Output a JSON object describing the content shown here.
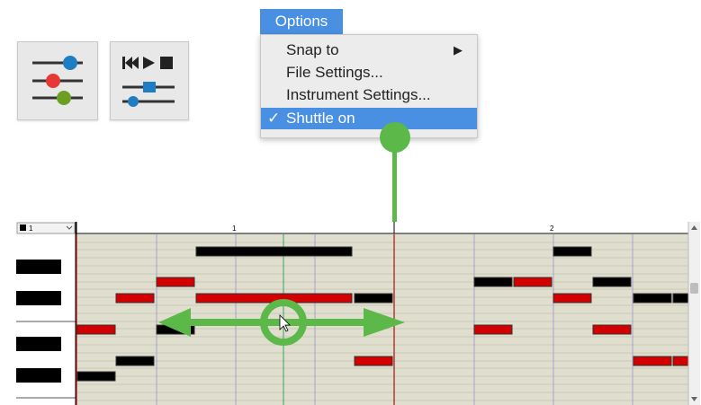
{
  "menu": {
    "title": "Options",
    "items": [
      {
        "label": "Snap to",
        "has_submenu": true,
        "arrow": "▶"
      },
      {
        "label": "File Settings...",
        "has_submenu": false
      },
      {
        "label": "Instrument Settings...",
        "has_submenu": false
      },
      {
        "label": "Shuttle on",
        "checked": true,
        "check": "✓"
      }
    ]
  },
  "editor": {
    "track_selector": "1",
    "measures": [
      "1",
      "2"
    ]
  },
  "colors": {
    "menu_highlight": "#4a90e2",
    "callout_green": "#5cb849",
    "note_black": "#000000",
    "note_red": "#d20000",
    "grid_background": "#e0dfcf"
  },
  "icons": {
    "mixer_button": "mixer-sliders-icon",
    "transport_button": "transport-controls-icon",
    "shuttle_cursor": "shuttle-arrows-icon"
  }
}
